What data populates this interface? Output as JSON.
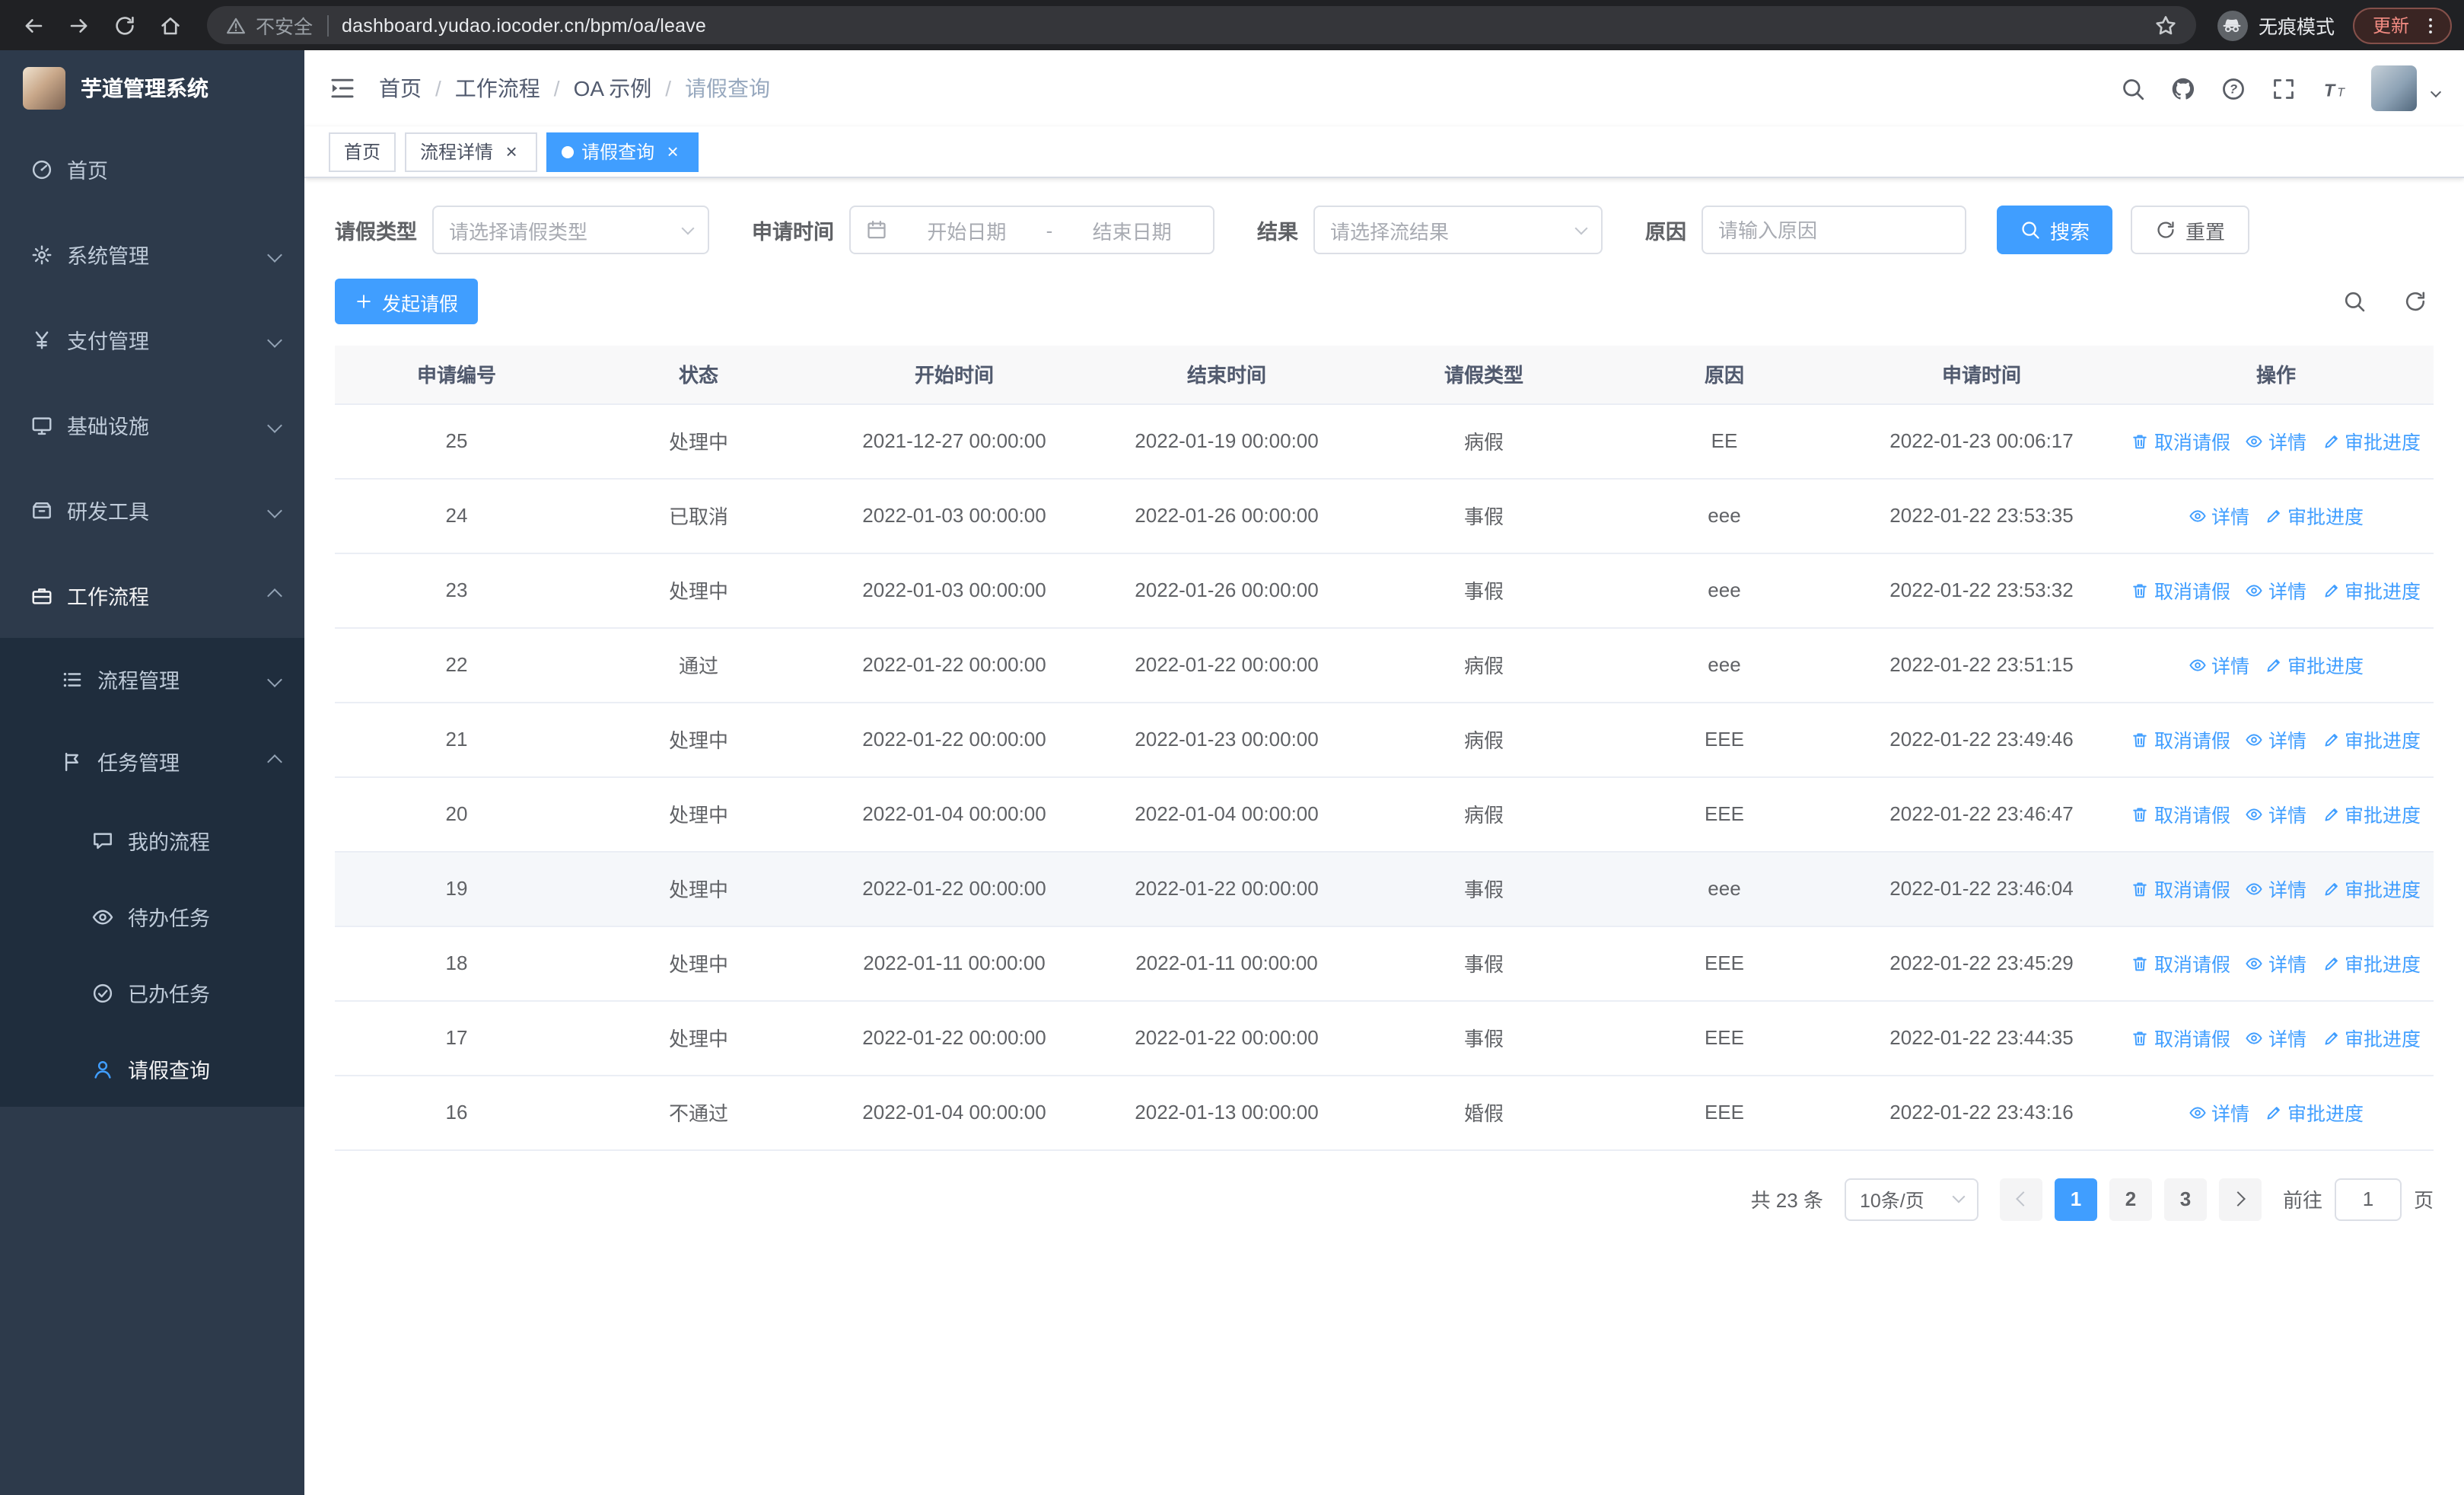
{
  "browser": {
    "security_chip": "不安全",
    "url": "dashboard.yudao.iocoder.cn/bpm/oa/leave",
    "incognito_label": "无痕模式",
    "update_button": "更新"
  },
  "sidebar": {
    "logo_title": "芋道管理系统",
    "menu": [
      {
        "label": "首页",
        "icon": "dashboard",
        "level": 1
      },
      {
        "label": "系统管理",
        "icon": "gear",
        "level": 1,
        "chevron": "down"
      },
      {
        "label": "支付管理",
        "icon": "yen",
        "level": 1,
        "chevron": "down"
      },
      {
        "label": "基础设施",
        "icon": "monitor",
        "level": 1,
        "chevron": "down"
      },
      {
        "label": "研发工具",
        "icon": "box",
        "level": 1,
        "chevron": "down"
      },
      {
        "label": "工作流程",
        "icon": "briefcase",
        "level": 1,
        "chevron": "up",
        "active": true
      },
      {
        "label": "流程管理",
        "icon": "list",
        "level": 2,
        "chevron": "down"
      },
      {
        "label": "任务管理",
        "icon": "flag",
        "level": 2,
        "chevron": "up"
      },
      {
        "label": "我的流程",
        "icon": "chat",
        "level": 3
      },
      {
        "label": "待办任务",
        "icon": "eye",
        "level": 3
      },
      {
        "label": "已办任务",
        "icon": "check",
        "level": 3
      },
      {
        "label": "请假查询",
        "icon": "user",
        "level": 3,
        "active": true
      }
    ]
  },
  "header": {
    "breadcrumb": [
      "首页",
      "工作流程",
      "OA 示例",
      "请假查询"
    ]
  },
  "tabs": [
    {
      "label": "首页",
      "closable": false,
      "active": false
    },
    {
      "label": "流程详情",
      "closable": true,
      "active": false
    },
    {
      "label": "请假查询",
      "closable": true,
      "active": true
    }
  ],
  "filters": {
    "leave_type_label": "请假类型",
    "leave_type_placeholder": "请选择请假类型",
    "apply_time_label": "申请时间",
    "start_date_placeholder": "开始日期",
    "range_separator": "-",
    "end_date_placeholder": "结束日期",
    "result_label": "结果",
    "result_placeholder": "请选择流结果",
    "reason_label": "原因",
    "reason_placeholder": "请输入原因",
    "search_button": "搜索",
    "reset_button": "重置"
  },
  "toolbar": {
    "create_button": "发起请假"
  },
  "table": {
    "columns": [
      "申请编号",
      "状态",
      "开始时间",
      "结束时间",
      "请假类型",
      "原因",
      "申请时间",
      "操作"
    ],
    "rows": [
      {
        "no": "25",
        "status": "处理中",
        "start": "2021-12-27 00:00:00",
        "end": "2022-01-19 00:00:00",
        "type": "病假",
        "reason": "EE",
        "applied": "2022-01-23 00:06:17",
        "actions": [
          "cancel",
          "detail",
          "progress"
        ]
      },
      {
        "no": "24",
        "status": "已取消",
        "start": "2022-01-03 00:00:00",
        "end": "2022-01-26 00:00:00",
        "type": "事假",
        "reason": "eee",
        "applied": "2022-01-22 23:53:35",
        "actions": [
          "detail",
          "progress"
        ]
      },
      {
        "no": "23",
        "status": "处理中",
        "start": "2022-01-03 00:00:00",
        "end": "2022-01-26 00:00:00",
        "type": "事假",
        "reason": "eee",
        "applied": "2022-01-22 23:53:32",
        "actions": [
          "cancel",
          "detail",
          "progress"
        ]
      },
      {
        "no": "22",
        "status": "通过",
        "start": "2022-01-22 00:00:00",
        "end": "2022-01-22 00:00:00",
        "type": "病假",
        "reason": "eee",
        "applied": "2022-01-22 23:51:15",
        "actions": [
          "detail",
          "progress"
        ]
      },
      {
        "no": "21",
        "status": "处理中",
        "start": "2022-01-22 00:00:00",
        "end": "2022-01-23 00:00:00",
        "type": "病假",
        "reason": "EEE",
        "applied": "2022-01-22 23:49:46",
        "actions": [
          "cancel",
          "detail",
          "progress"
        ]
      },
      {
        "no": "20",
        "status": "处理中",
        "start": "2022-01-04 00:00:00",
        "end": "2022-01-04 00:00:00",
        "type": "病假",
        "reason": "EEE",
        "applied": "2022-01-22 23:46:47",
        "actions": [
          "cancel",
          "detail",
          "progress"
        ]
      },
      {
        "no": "19",
        "status": "处理中",
        "start": "2022-01-22 00:00:00",
        "end": "2022-01-22 00:00:00",
        "type": "事假",
        "reason": "eee",
        "applied": "2022-01-22 23:46:04",
        "actions": [
          "cancel",
          "detail",
          "progress"
        ],
        "highlighted": true
      },
      {
        "no": "18",
        "status": "处理中",
        "start": "2022-01-11 00:00:00",
        "end": "2022-01-11 00:00:00",
        "type": "事假",
        "reason": "EEE",
        "applied": "2022-01-22 23:45:29",
        "actions": [
          "cancel",
          "detail",
          "progress"
        ]
      },
      {
        "no": "17",
        "status": "处理中",
        "start": "2022-01-22 00:00:00",
        "end": "2022-01-22 00:00:00",
        "type": "事假",
        "reason": "EEE",
        "applied": "2022-01-22 23:44:35",
        "actions": [
          "cancel",
          "detail",
          "progress"
        ]
      },
      {
        "no": "16",
        "status": "不通过",
        "start": "2022-01-04 00:00:00",
        "end": "2022-01-13 00:00:00",
        "type": "婚假",
        "reason": "EEE",
        "applied": "2022-01-22 23:43:16",
        "actions": [
          "detail",
          "progress"
        ]
      }
    ]
  },
  "action_labels": {
    "cancel": "取消请假",
    "detail": "详情",
    "progress": "审批进度"
  },
  "pagination": {
    "total": "共 23 条",
    "page_size": "10条/页",
    "pages": [
      "1",
      "2",
      "3"
    ],
    "active_page": "1",
    "goto_label": "前往",
    "goto_value": "1",
    "page_unit": "页"
  }
}
